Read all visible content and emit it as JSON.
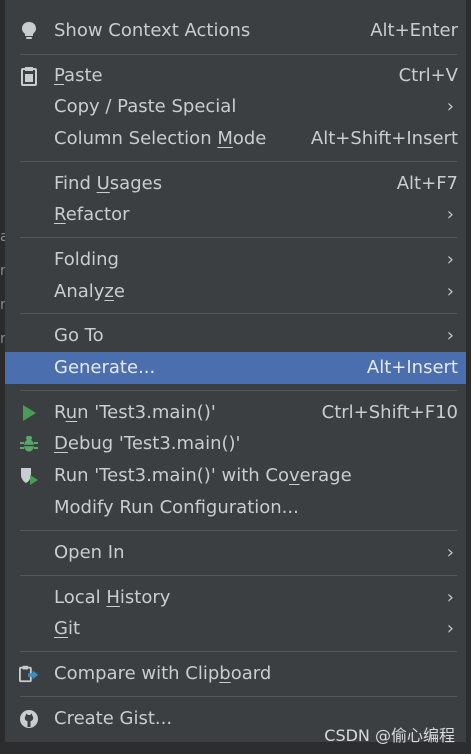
{
  "menu": {
    "show_context_actions": {
      "label": "Show Context Actions",
      "shortcut": "Alt+Enter"
    },
    "paste": {
      "pre": "",
      "mnemonic": "P",
      "post": "aste",
      "shortcut": "Ctrl+V"
    },
    "copy_paste_special": {
      "label": "Copy / Paste Special"
    },
    "column_selection_mode": {
      "pre": "Column Selection ",
      "mnemonic": "M",
      "post": "ode",
      "shortcut": "Alt+Shift+Insert"
    },
    "find_usages": {
      "pre": "Find ",
      "mnemonic": "U",
      "post": "sages",
      "shortcut": "Alt+F7"
    },
    "refactor": {
      "pre": "",
      "mnemonic": "R",
      "post": "efactor"
    },
    "folding": {
      "label": "Folding"
    },
    "analyze": {
      "pre": "Analy",
      "mnemonic": "z",
      "post": "e"
    },
    "go_to": {
      "label": "Go To"
    },
    "generate": {
      "label": "Generate...",
      "shortcut": "Alt+Insert"
    },
    "run": {
      "pre": "R",
      "mnemonic": "u",
      "post": "n 'Test3.main()'",
      "shortcut": "Ctrl+Shift+F10"
    },
    "debug": {
      "pre": "",
      "mnemonic": "D",
      "post": "ebug 'Test3.main()'"
    },
    "run_coverage": {
      "pre": "Run 'Test3.main()' with Co",
      "mnemonic": "v",
      "post": "erage"
    },
    "modify_run_config": {
      "label": "Modify Run Configuration..."
    },
    "open_in": {
      "label": "Open In"
    },
    "local_history": {
      "pre": "Local ",
      "mnemonic": "H",
      "post": "istory"
    },
    "git": {
      "pre": "",
      "mnemonic": "G",
      "post": "it"
    },
    "compare_clipboard": {
      "pre": "Compare with Clip",
      "mnemonic": "b",
      "post": "oard"
    },
    "create_gist": {
      "label": "Create Gist..."
    },
    "submenu_chevron": "›"
  },
  "edge_glyphs": [
    "a",
    "r",
    "r",
    "r"
  ],
  "watermark": "CSDN @偷心编程",
  "colors": {
    "menu_background": "#3c3f41",
    "selection": "#4b6eaf",
    "text": "#c9cdd1",
    "separator": "#55585b",
    "run_green": "#499c54",
    "debug_green": "#59a869"
  },
  "icons": {
    "show_context_actions": "lightbulb-icon",
    "paste": "clipboard-icon",
    "run": "play-icon",
    "debug": "bug-icon",
    "run_coverage": "coverage-shield-icon",
    "compare_clipboard": "compare-clipboard-icon",
    "create_gist": "github-icon"
  }
}
